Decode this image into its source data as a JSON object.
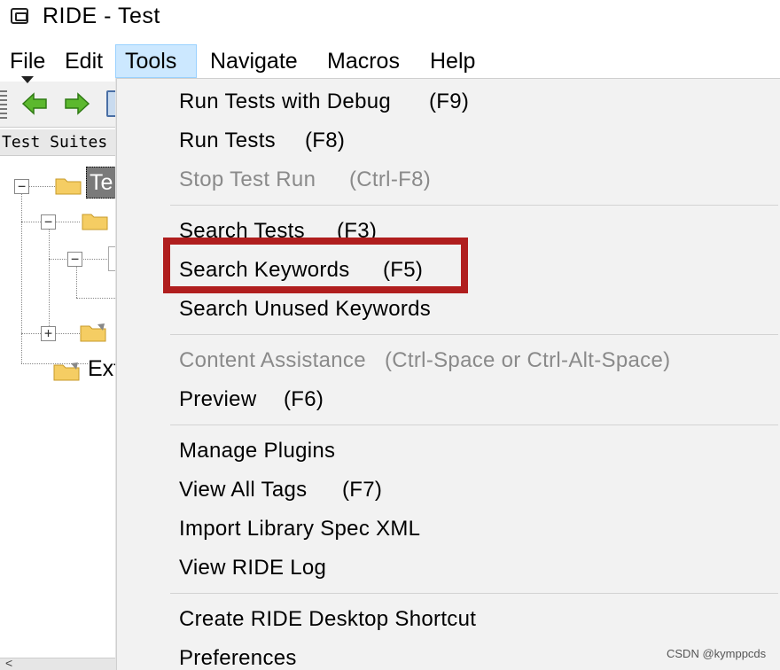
{
  "window": {
    "title": "RIDE - Test"
  },
  "menubar": {
    "items": [
      {
        "label": "File"
      },
      {
        "label": "Edit"
      },
      {
        "label": "Tools"
      },
      {
        "label": "Navigate"
      },
      {
        "label": "Macros"
      },
      {
        "label": "Help"
      }
    ]
  },
  "left_pane": {
    "header": "Test Suites",
    "selected_node_label": "Te",
    "ext_label": "Ext",
    "scroll_left_glyph": "<"
  },
  "tools_menu": {
    "items": [
      {
        "label": "Run Tests with Debug",
        "accel": "(F9)",
        "enabled": true
      },
      {
        "label": "Run Tests",
        "accel": "(F8)",
        "enabled": true
      },
      {
        "label": "Stop Test Run",
        "accel": "(Ctrl-F8)",
        "enabled": false
      },
      {
        "label": "Search Tests",
        "accel": "(F3)",
        "enabled": true
      },
      {
        "label": "Search Keywords",
        "accel": "(F5)",
        "enabled": true,
        "highlighted": true
      },
      {
        "label": "Search Unused Keywords",
        "accel": "",
        "enabled": true
      },
      {
        "label": "Content Assistance",
        "accel": "(Ctrl-Space or Ctrl-Alt-Space)",
        "enabled": false
      },
      {
        "label": "Preview",
        "accel": "(F6)",
        "enabled": true
      },
      {
        "label": "Manage Plugins",
        "accel": "",
        "enabled": true
      },
      {
        "label": "View All Tags",
        "accel": "(F7)",
        "enabled": true
      },
      {
        "label": "Import Library Spec XML",
        "accel": "",
        "enabled": true
      },
      {
        "label": "View RIDE Log",
        "accel": "",
        "enabled": true
      },
      {
        "label": "Create RIDE Desktop Shortcut",
        "accel": "",
        "enabled": true
      },
      {
        "label": "Preferences",
        "accel": "",
        "enabled": true
      }
    ]
  },
  "watermark": "CSDN @kymppcds",
  "colors": {
    "highlight_border": "#b01e1e",
    "active_menu_bg": "#cce8ff",
    "disabled_text": "#8a8a8a"
  }
}
